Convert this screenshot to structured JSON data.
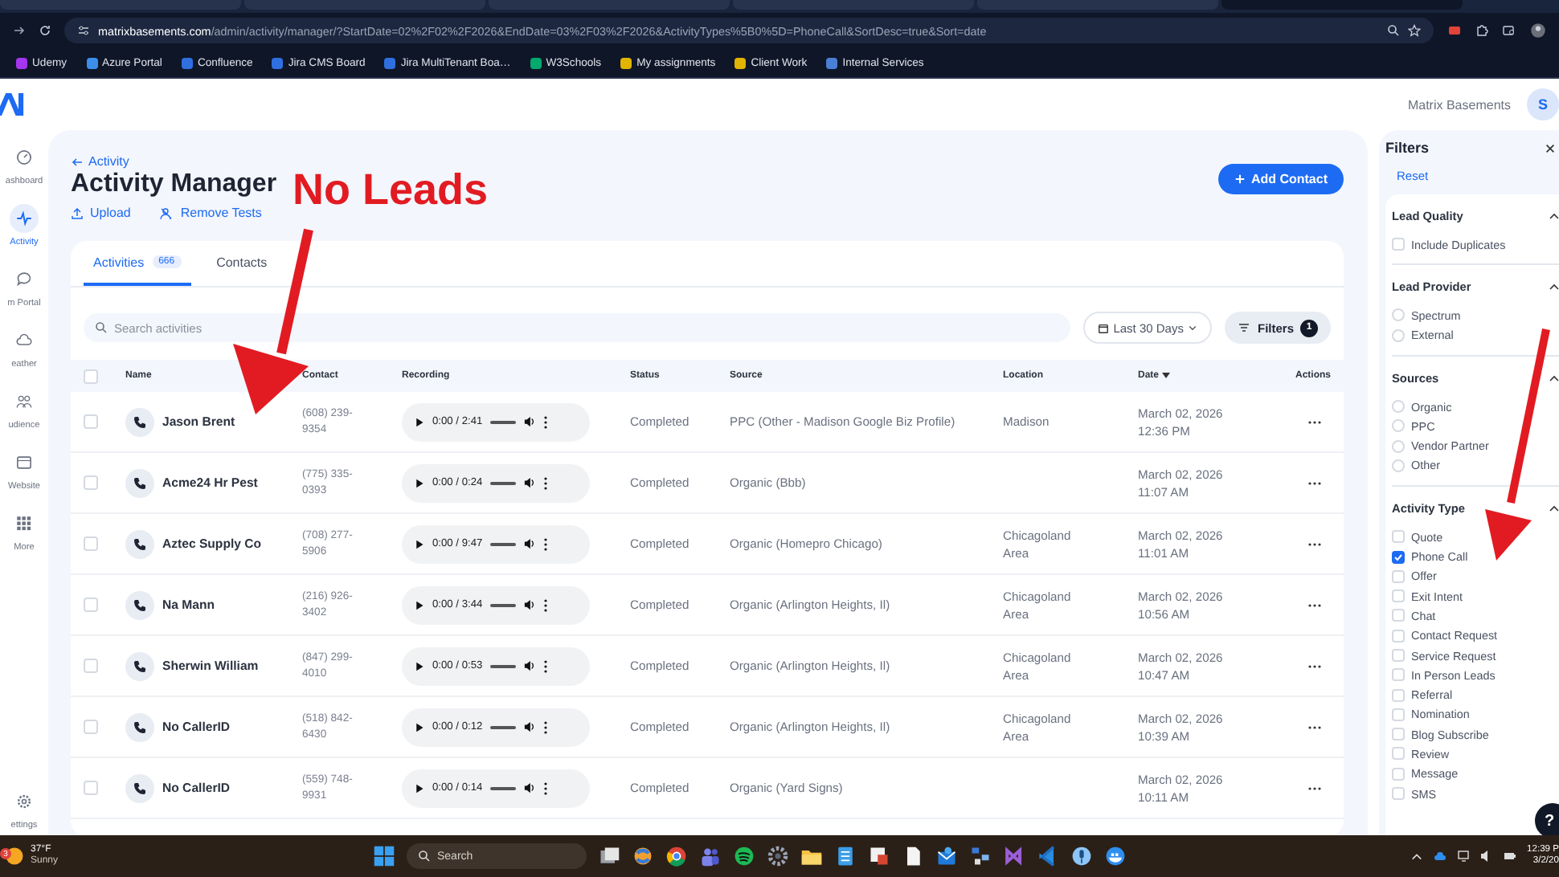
{
  "browser": {
    "url_host": "matrixbasements.com",
    "url_path": "/admin/activity/manager/?StartDate=02%2F02%2F2026&EndDate=03%2F03%2F2026&ActivityTypes%5B0%5D=PhoneCall&SortDesc=true&Sort=date",
    "bookmarks": [
      {
        "label": "Udemy",
        "color": "#a435f0"
      },
      {
        "label": "Azure Portal",
        "color": "#3b8eea"
      },
      {
        "label": "Confluence",
        "color": "#2f6fe0"
      },
      {
        "label": "Jira CMS Board",
        "color": "#2f6fe0"
      },
      {
        "label": "Jira MultiTenant Boa…",
        "color": "#2f6fe0"
      },
      {
        "label": "W3Schools",
        "color": "#04aa6d"
      },
      {
        "label": "My assignments",
        "color": "#e0b400"
      },
      {
        "label": "Client Work",
        "color": "#e0b400"
      },
      {
        "label": "Internal Services",
        "color": "#4a7fd6"
      }
    ]
  },
  "header": {
    "account": "Matrix Basements",
    "avatar": "S"
  },
  "sidebar": {
    "items": [
      {
        "label": "ashboard",
        "kind": "gauge",
        "selected": false
      },
      {
        "label": "Activity",
        "kind": "pulse",
        "selected": true
      },
      {
        "label": "m Portal",
        "kind": "chat",
        "selected": false
      },
      {
        "label": "eather",
        "kind": "cloud",
        "selected": false
      },
      {
        "label": "udience",
        "kind": "people",
        "selected": false
      },
      {
        "label": "Website",
        "kind": "window",
        "selected": false
      },
      {
        "label": "More",
        "kind": "grid",
        "selected": false
      }
    ],
    "footer": {
      "label": "ettings",
      "kind": "gear"
    }
  },
  "breadcrumb": "Activity",
  "title": "Activity Manager",
  "actions": [
    {
      "label": "Upload",
      "kind": "upload"
    },
    {
      "label": "Remove Tests",
      "kind": "remove-user"
    }
  ],
  "add_button": "Add Contact",
  "annotation": "No Leads",
  "tabs": [
    {
      "label": "Activities",
      "count": "666",
      "selected": true
    },
    {
      "label": "Contacts",
      "selected": false
    }
  ],
  "search": {
    "placeholder": "Search activities"
  },
  "date_range": "Last 30 Days",
  "filters_button": {
    "label": "Filters",
    "count": "1"
  },
  "table": {
    "select_all": {
      "checked": false
    },
    "columns": [
      {
        "label": "Name",
        "sorted": false
      },
      {
        "label": "Contact",
        "sorted": false
      },
      {
        "label": "Recording",
        "sorted": false
      },
      {
        "label": "Status",
        "sorted": false
      },
      {
        "label": "Source",
        "sorted": false
      },
      {
        "label": "Location",
        "sorted": false
      },
      {
        "label": "Date",
        "sorted": true
      },
      {
        "label": "Actions",
        "sorted": false
      }
    ],
    "rows": [
      {
        "checked": false,
        "name": "Jason Brent",
        "contact": "(608) 239-9354",
        "recording": "0:00 / 2:41",
        "status": "Completed",
        "source": "PPC (Other - Madison Google Biz Profile)",
        "location": "Madison",
        "date": "March 02, 2026",
        "time": "12:36 PM"
      },
      {
        "checked": false,
        "name": "Acme24 Hr Pest",
        "contact": "(775) 335-0393",
        "recording": "0:00 / 0:24",
        "status": "Completed",
        "source": "Organic (Bbb)",
        "date": "March 02, 2026",
        "time": "11:07 AM"
      },
      {
        "checked": false,
        "name": "Aztec Supply Co",
        "contact": "(708) 277-5906",
        "recording": "0:00 / 9:47",
        "status": "Completed",
        "source": "Organic (Homepro Chicago)",
        "location": "Chicagoland Area",
        "date": "March 02, 2026",
        "time": "11:01 AM"
      },
      {
        "checked": false,
        "name": "Na Mann",
        "contact": "(216) 926-3402",
        "recording": "0:00 / 3:44",
        "status": "Completed",
        "source": "Organic (Arlington Heights, Il)",
        "location": "Chicagoland Area",
        "date": "March 02, 2026",
        "time": "10:56 AM"
      },
      {
        "checked": false,
        "name": "Sherwin William",
        "contact": "(847) 299-4010",
        "recording": "0:00 / 0:53",
        "status": "Completed",
        "source": "Organic (Arlington Heights, Il)",
        "location": "Chicagoland Area",
        "date": "March 02, 2026",
        "time": "10:47 AM"
      },
      {
        "checked": false,
        "name": "No CallerID",
        "contact": "(518) 842-6430",
        "recording": "0:00 / 0:12",
        "status": "Completed",
        "source": "Organic (Arlington Heights, Il)",
        "location": "Chicagoland Area",
        "date": "March 02, 2026",
        "time": "10:39 AM"
      },
      {
        "checked": false,
        "name": "No CallerID",
        "contact": "(559) 748-9931",
        "recording": "0:00 / 0:14",
        "status": "Completed",
        "source": "Organic (Yard Signs)",
        "date": "March 02, 2026",
        "time": "10:11 AM"
      }
    ]
  },
  "filters": {
    "title": "Filters",
    "reset": "Reset",
    "sections": [
      {
        "title": "Lead Quality",
        "kind": "checkbox",
        "expanded": true,
        "options": [
          {
            "label": "Include Duplicates",
            "checked": false
          }
        ]
      },
      {
        "title": "Lead Provider",
        "kind": "radio",
        "expanded": true,
        "options": [
          {
            "label": "Spectrum",
            "checked": false
          },
          {
            "label": "External",
            "checked": false
          }
        ]
      },
      {
        "title": "Sources",
        "kind": "radio",
        "expanded": true,
        "options": [
          {
            "label": "Organic",
            "checked": false
          },
          {
            "label": "PPC",
            "checked": false
          },
          {
            "label": "Vendor Partner",
            "checked": false
          },
          {
            "label": "Other",
            "checked": false
          }
        ]
      },
      {
        "title": "Activity Type",
        "kind": "checkbox",
        "expanded": true,
        "options": [
          {
            "label": "Quote",
            "checked": false
          },
          {
            "label": "Phone Call",
            "checked": true
          },
          {
            "label": "Offer",
            "checked": false
          },
          {
            "label": "Exit Intent",
            "checked": false
          },
          {
            "label": "Chat",
            "checked": false
          },
          {
            "label": "Contact Request",
            "checked": false
          },
          {
            "label": "Service Request",
            "checked": false
          },
          {
            "label": "In Person Leads",
            "checked": false
          },
          {
            "label": "Referral",
            "checked": false
          },
          {
            "label": "Nomination",
            "checked": false
          },
          {
            "label": "Blog Subscribe",
            "checked": false
          },
          {
            "label": "Review",
            "checked": false
          },
          {
            "label": "Message",
            "checked": false
          },
          {
            "label": "SMS",
            "checked": false
          }
        ]
      }
    ]
  },
  "help": "?",
  "taskbar": {
    "weather": {
      "badge": "3",
      "temp": "37°F",
      "condition": "Sunny"
    },
    "search_placeholder": "Search",
    "time": "12:39 P",
    "date": "3/2/20"
  }
}
